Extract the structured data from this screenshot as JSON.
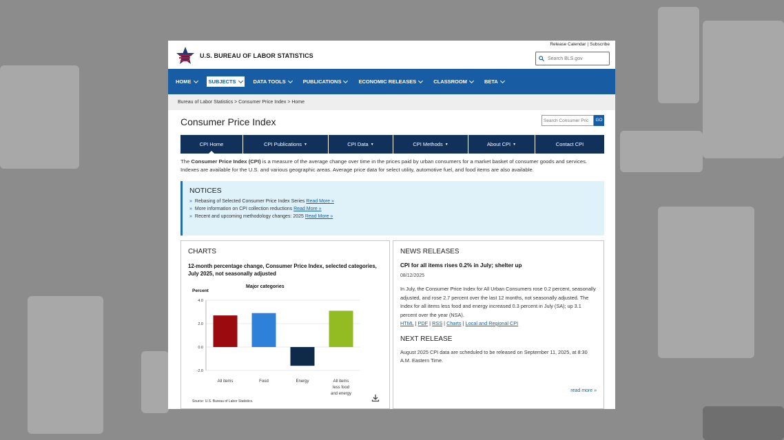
{
  "header": {
    "agency": "U.S. BUREAU OF LABOR STATISTICS",
    "toplinks": [
      "Release Calendar",
      "Subscribe"
    ],
    "search_placeholder": "Search BLS.gov"
  },
  "nav": {
    "items": [
      {
        "label": "HOME"
      },
      {
        "label": "SUBJECTS"
      },
      {
        "label": "DATA TOOLS"
      },
      {
        "label": "PUBLICATIONS"
      },
      {
        "label": "ECONOMIC RELEASES"
      },
      {
        "label": "CLASSROOM"
      },
      {
        "label": "BETA"
      }
    ]
  },
  "breadcrumb": "Bureau of Labor Statistics > Consumer Price Index > Home",
  "page_title": "Consumer Price Index",
  "cpi_search": {
    "placeholder": "Search Consumer Pric",
    "button": "GO"
  },
  "subnav": {
    "items": [
      {
        "label": "CPI Home"
      },
      {
        "label": "CPI Publications"
      },
      {
        "label": "CPI Data"
      },
      {
        "label": "CPI Methods"
      },
      {
        "label": "About CPI"
      },
      {
        "label": "Contact CPI"
      }
    ]
  },
  "intro": {
    "prefix": "The ",
    "bold": "Consumer Price Index (CPI)",
    "text": " is a measure of the average change over time in the prices paid by urban consumers for a market basket of consumer goods and services. Indexes are available for the U.S. and various geographic areas. Average price data for select utility, automotive fuel, and food items are also available."
  },
  "notices": {
    "heading": "NOTICES",
    "items": [
      {
        "text": "Rebasing of Selected Consumer Price Index Series",
        "link": "Read More »"
      },
      {
        "text": "More information on CPI collection reductions",
        "link": "Read More »"
      },
      {
        "text": "Recent and upcoming methodology changes: 2025",
        "link": "Read More »"
      }
    ]
  },
  "charts": {
    "heading": "CHARTS",
    "title": "12-month percentage change, Consumer Price Index, selected categories, July 2025, not seasonally adjusted",
    "source": "Source: U.S. Bureau of Labor Statistics."
  },
  "chart_data": {
    "type": "bar",
    "title": "Major categories",
    "ylabel": "Percent",
    "categories": [
      "All items",
      "Food",
      "Energy",
      "All items less food and energy"
    ],
    "category_lines": [
      [
        "All items"
      ],
      [
        "Food"
      ],
      [
        "Energy"
      ],
      [
        "All items",
        "less food",
        "and energy"
      ]
    ],
    "values": [
      2.7,
      2.9,
      -1.6,
      3.1
    ],
    "colors": [
      "#9b0a0f",
      "#2f80d8",
      "#0f2a48",
      "#93bb22"
    ],
    "ylim": [
      -2.0,
      4.0
    ],
    "yticks": [
      4.0,
      2.0,
      0.0,
      -2.0
    ],
    "ytick_labels": [
      "4.0",
      "2.0",
      "0.0",
      "-2.0"
    ],
    "grid": true
  },
  "news": {
    "heading": "NEWS RELEASES",
    "title": "CPI for all items rises 0.2% in July; shelter up",
    "date": "08/12/2025",
    "body": "In July, the Consumer Price Index for All Urban Consumers rose 0.2 percent, seasonally adjusted, and rose 2.7 percent over the last 12 months, not seasonally adjusted. The Index for all items less food and energy increased 0.3 percent in July (SA); up 3.1 percent over the year (NSA).",
    "links": [
      "HTML",
      "PDF",
      "RSS",
      "Charts",
      "Local and Regional CPI"
    ]
  },
  "next_release": {
    "heading": "NEXT RELEASE",
    "body": "August 2025 CPI data are scheduled to be released on September 11, 2025, at 8:30 A.M. Eastern Time.",
    "read_more": "read more »"
  }
}
